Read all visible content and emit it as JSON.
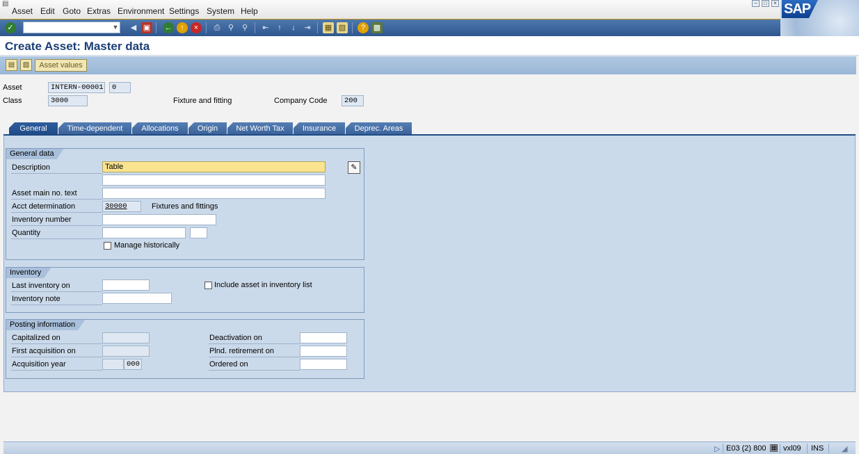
{
  "menu": {
    "items": [
      "Asset",
      "Edit",
      "Goto",
      "Extras",
      "Environment",
      "Settings",
      "System",
      "Help"
    ]
  },
  "brand": {
    "logo_text": "SAP",
    "accent": "#1c3f76"
  },
  "toolbar": {
    "command_field_value": "",
    "icons": [
      "enter-icon",
      "back-arrow-icon",
      "save-icon",
      "back-icon",
      "exit-icon",
      "cancel-icon",
      "print-icon",
      "find-icon",
      "find-next-icon",
      "first-page-icon",
      "previous-page-icon",
      "next-page-icon",
      "last-page-icon",
      "create-session-icon",
      "shortcut-icon",
      "help-icon",
      "layout-icon"
    ]
  },
  "title": "Create Asset:  Master data",
  "app_toolbar": {
    "asset_values_label": "Asset values"
  },
  "header": {
    "asset_label": "Asset",
    "asset_number": "INTERN-00001",
    "asset_subnumber": "0",
    "class_label": "Class",
    "class_value": "3000",
    "class_text": "Fixture and fitting",
    "company_code_label": "Company Code",
    "company_code_value": "200"
  },
  "tabs": [
    {
      "label": "General",
      "active": true
    },
    {
      "label": "Time-dependent",
      "active": false
    },
    {
      "label": "Allocations",
      "active": false
    },
    {
      "label": "Origin",
      "active": false
    },
    {
      "label": "Net Worth Tax",
      "active": false
    },
    {
      "label": "Insurance",
      "active": false
    },
    {
      "label": "Deprec. Areas",
      "active": false
    }
  ],
  "general_data": {
    "title": "General data",
    "description_label": "Description",
    "description_value": "Table",
    "description_line2": "",
    "main_no_text_label": "Asset main no. text",
    "main_no_text_value": "",
    "acct_determination_label": "Acct determination",
    "acct_determination_value": "30000",
    "acct_determination_text": "Fixtures and fittings",
    "inventory_number_label": "Inventory number",
    "inventory_number_value": "",
    "quantity_label": "Quantity",
    "quantity_value": "",
    "quantity_unit": "",
    "manage_historically_label": "Manage historically",
    "manage_historically_checked": false
  },
  "inventory": {
    "title": "Inventory",
    "last_inventory_label": "Last inventory on",
    "last_inventory_value": "",
    "inventory_note_label": "Inventory note",
    "inventory_note_value": "",
    "include_in_list_label": "Include asset in inventory list",
    "include_in_list_checked": false
  },
  "posting": {
    "title": "Posting information",
    "capitalized_label": "Capitalized on",
    "capitalized_value": "",
    "first_acq_label": "First acquisition on",
    "first_acq_value": "",
    "acq_year_label": "Acquisition year",
    "acq_year_value": "",
    "acq_period_value": "000",
    "deactivation_label": "Deactivation on",
    "deactivation_value": "",
    "plnd_retirement_label": "Plnd. retirement on",
    "plnd_retirement_value": "",
    "ordered_label": "Ordered on",
    "ordered_value": ""
  },
  "status": {
    "system": "E03 (2) 800",
    "server": "vxl09",
    "mode": "INS"
  }
}
